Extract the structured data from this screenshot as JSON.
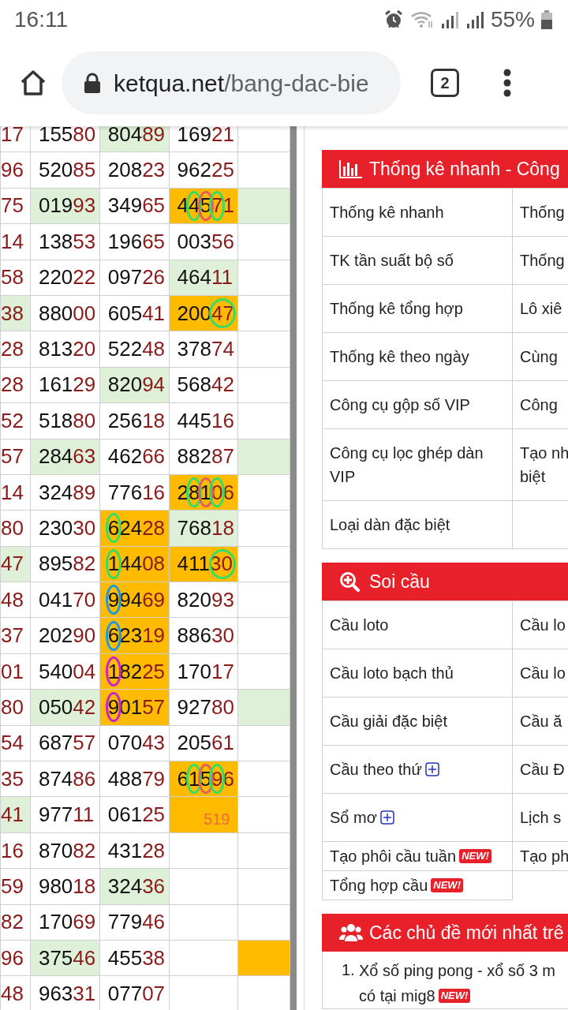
{
  "status_bar": {
    "time": "16:11",
    "battery": "55%"
  },
  "browser": {
    "domain": "ketqua.net",
    "path": "/bang-dac-bie",
    "tab_count": "2"
  },
  "results_table": {
    "rows": [
      [
        {
          "tail": "17"
        },
        {
          "lead": "155",
          "tail": "80"
        },
        {
          "lead": "804",
          "tail": "89",
          "color": "#dff0d8"
        },
        {
          "lead": "169",
          "tail": "21"
        },
        {}
      ],
      [
        {
          "tail": "96"
        },
        {
          "lead": "520",
          "tail": "85"
        },
        {
          "lead": "208",
          "tail": "23"
        },
        {
          "lead": "962",
          "tail": "25"
        },
        {}
      ],
      [
        {
          "tail": "75"
        },
        {
          "lead": "019",
          "tail": "93",
          "color": "#dff0d8"
        },
        {
          "lead": "349",
          "tail": "65"
        },
        {
          "lead": "445",
          "tail": "71",
          "color": "#ffbb00",
          "circles": [
            {
              "kind": "second",
              "color": "#33dd66"
            },
            {
              "kind": "third",
              "color": "#e06060"
            },
            {
              "kind": "fourth",
              "color": "#33dd66"
            }
          ]
        },
        {
          "color": "#dff0d8"
        }
      ],
      [
        {
          "tail": "14"
        },
        {
          "lead": "138",
          "tail": "53"
        },
        {
          "lead": "196",
          "tail": "65"
        },
        {
          "lead": "003",
          "tail": "56"
        },
        {}
      ],
      [
        {
          "tail": "58"
        },
        {
          "lead": "220",
          "tail": "22"
        },
        {
          "lead": "097",
          "tail": "26"
        },
        {
          "lead": "464",
          "tail": "11",
          "color": "#dff0d8"
        },
        {}
      ],
      [
        {
          "tail": "38",
          "color": "#dff0d8"
        },
        {
          "lead": "880",
          "tail": "00"
        },
        {
          "lead": "605",
          "tail": "41"
        },
        {
          "lead": "200",
          "tail": "47",
          "color": "#ffbb00",
          "circles": [
            {
              "kind": "pair",
              "color": "#33dd66"
            }
          ]
        },
        {}
      ],
      [
        {
          "tail": "28"
        },
        {
          "lead": "813",
          "tail": "20"
        },
        {
          "lead": "522",
          "tail": "48"
        },
        {
          "lead": "378",
          "tail": "74"
        },
        {}
      ],
      [
        {
          "tail": "28"
        },
        {
          "lead": "161",
          "tail": "29"
        },
        {
          "lead": "820",
          "tail": "94",
          "color": "#dff0d8"
        },
        {
          "lead": "568",
          "tail": "42"
        },
        {}
      ],
      [
        {
          "tail": "52"
        },
        {
          "lead": "518",
          "tail": "80"
        },
        {
          "lead": "256",
          "tail": "18"
        },
        {
          "lead": "445",
          "tail": "16"
        },
        {}
      ],
      [
        {
          "tail": "57"
        },
        {
          "lead": "284",
          "tail": "63",
          "color": "#dff0d8"
        },
        {
          "lead": "462",
          "tail": "66"
        },
        {
          "lead": "882",
          "tail": "87"
        },
        {
          "color": "#dff0d8"
        }
      ],
      [
        {
          "tail": "14"
        },
        {
          "lead": "324",
          "tail": "89"
        },
        {
          "lead": "776",
          "tail": "16"
        },
        {
          "lead": "281",
          "tail": "06",
          "color": "#ffbb00",
          "circles": [
            {
              "kind": "second",
              "color": "#33dd66"
            },
            {
              "kind": "third",
              "color": "#e06060"
            },
            {
              "kind": "fourth",
              "color": "#33dd66"
            }
          ]
        },
        {}
      ],
      [
        {
          "tail": "80"
        },
        {
          "lead": "230",
          "tail": "30"
        },
        {
          "lead": "624",
          "tail": "28",
          "color": "#ffbb00",
          "circles": [
            {
              "kind": "first",
              "color": "#33dd66"
            }
          ]
        },
        {
          "lead": "768",
          "tail": "18",
          "color": "#dff0d8"
        },
        {}
      ],
      [
        {
          "tail": "47",
          "color": "#dff0d8"
        },
        {
          "lead": "895",
          "tail": "82"
        },
        {
          "lead": "144",
          "tail": "08",
          "color": "#ffbb00",
          "circles": [
            {
              "kind": "first",
              "color": "#33dd66"
            }
          ]
        },
        {
          "lead": "411",
          "tail": "30",
          "color": "#ffbb00",
          "circles": [
            {
              "kind": "pair",
              "color": "#33dd66"
            }
          ]
        },
        {}
      ],
      [
        {
          "tail": "48"
        },
        {
          "lead": "041",
          "tail": "70"
        },
        {
          "lead": "994",
          "tail": "69",
          "color": "#ffbb00",
          "circles": [
            {
              "kind": "first",
              "color": "#1a9be0"
            }
          ]
        },
        {
          "lead": "820",
          "tail": "93"
        },
        {}
      ],
      [
        {
          "tail": "37"
        },
        {
          "lead": "202",
          "tail": "90"
        },
        {
          "lead": "623",
          "tail": "19",
          "color": "#ffbb00",
          "circles": [
            {
              "kind": "first",
              "color": "#1a9be0"
            }
          ]
        },
        {
          "lead": "886",
          "tail": "30"
        },
        {}
      ],
      [
        {
          "tail": "01"
        },
        {
          "lead": "540",
          "tail": "04"
        },
        {
          "lead": "182",
          "tail": "25",
          "color": "#ffbb00",
          "circles": [
            {
              "kind": "first",
              "color": "#cc22cc"
            }
          ]
        },
        {
          "lead": "170",
          "tail": "17"
        },
        {}
      ],
      [
        {
          "tail": "80"
        },
        {
          "lead": "050",
          "tail": "42",
          "color": "#dff0d8"
        },
        {
          "lead": "901",
          "tail": "57",
          "color": "#ffbb00",
          "circles": [
            {
              "kind": "first",
              "color": "#cc22cc"
            }
          ]
        },
        {
          "lead": "927",
          "tail": "80"
        },
        {
          "color": "#dff0d8"
        }
      ],
      [
        {
          "tail": "54"
        },
        {
          "lead": "687",
          "tail": "57"
        },
        {
          "lead": "070",
          "tail": "43"
        },
        {
          "lead": "205",
          "tail": "61"
        },
        {}
      ],
      [
        {
          "tail": "35"
        },
        {
          "lead": "874",
          "tail": "86"
        },
        {
          "lead": "488",
          "tail": "79"
        },
        {
          "lead": "615",
          "tail": "96",
          "color": "#ffbb00",
          "circles": [
            {
              "kind": "second",
              "color": "#33dd66"
            },
            {
              "kind": "third",
              "color": "#e06060"
            },
            {
              "kind": "fourth",
              "color": "#33dd66"
            }
          ]
        },
        {}
      ],
      [
        {
          "tail": "41",
          "color": "#dff0d8"
        },
        {
          "lead": "977",
          "tail": "11"
        },
        {
          "lead": "061",
          "tail": "25"
        },
        {
          "note": "519",
          "color": "#ffbb00"
        },
        {}
      ],
      [
        {
          "tail": "16"
        },
        {
          "lead": "870",
          "tail": "82"
        },
        {
          "lead": "431",
          "tail": "28"
        },
        {},
        {}
      ],
      [
        {
          "tail": "59"
        },
        {
          "lead": "980",
          "tail": "18"
        },
        {
          "lead": "324",
          "tail": "36",
          "color": "#dff0d8"
        },
        {},
        {}
      ],
      [
        {
          "tail": "82"
        },
        {
          "lead": "170",
          "tail": "69"
        },
        {
          "lead": "779",
          "tail": "46"
        },
        {},
        {}
      ],
      [
        {
          "tail": "96"
        },
        {
          "lead": "375",
          "tail": "46",
          "color": "#dff0d8"
        },
        {
          "lead": "455",
          "tail": "38"
        },
        {},
        {
          "color": "#ffbb00"
        }
      ],
      [
        {
          "tail": "48"
        },
        {
          "lead": "963",
          "tail": "31"
        },
        {
          "lead": "077",
          "tail": "07"
        },
        {},
        {}
      ]
    ]
  },
  "sections": [
    {
      "kind": "links",
      "title": "Thống kê nhanh - Công",
      "rows": [
        [
          {
            "text": "Thống kê nhanh"
          },
          {
            "text": "Thống"
          }
        ],
        [
          {
            "text": "TK tần suất bộ số"
          },
          {
            "text": "Thống"
          }
        ],
        [
          {
            "text": "Thống kê tổng hợp"
          },
          {
            "text": "Lô xiê"
          }
        ],
        [
          {
            "text": "Thống kê theo ngày"
          },
          {
            "text": "Cùng"
          }
        ],
        [
          {
            "text": "Công cụ gộp số VIP"
          },
          {
            "text": "Công"
          }
        ],
        [
          {
            "text": "Công cụ lọc ghép dàn VIP"
          },
          {
            "text": "Tạo nh\nbiệt"
          }
        ],
        [
          {
            "text": "Loại dàn đặc biệt"
          },
          {}
        ]
      ]
    },
    {
      "kind": "links",
      "title": "Soi cầu",
      "rows": [
        [
          {
            "text": "Cầu loto"
          },
          {
            "text": "Cầu lo"
          }
        ],
        [
          {
            "text": "Cầu loto bạch thủ"
          },
          {
            "text": "Cầu lo"
          }
        ],
        [
          {
            "text": "Cầu giải đặc biệt"
          },
          {
            "text": "Cầu ă"
          }
        ],
        [
          {
            "text": "Cầu theo thứ",
            "expand_icon": true
          },
          {
            "text": "Cầu Đ"
          }
        ],
        [
          {
            "text": "Sổ mơ",
            "expand_icon": true
          },
          {
            "text": "Lịch s"
          }
        ],
        [
          {
            "text": "Tạo phôi cầu tuần",
            "badge": "NEW!"
          },
          {
            "text": "Tạo ph"
          }
        ],
        [
          {
            "text": "Tổng hợp cầu",
            "badge": "NEW!"
          }
        ]
      ]
    },
    {
      "kind": "topics",
      "title": "Các chủ đề mới nhất trê",
      "items": [
        {
          "number": "1.",
          "lines": [
            "Xổ số ping pong - xổ số 3 m",
            "có tại mig8"
          ],
          "badge": "NEW!"
        }
      ]
    }
  ]
}
